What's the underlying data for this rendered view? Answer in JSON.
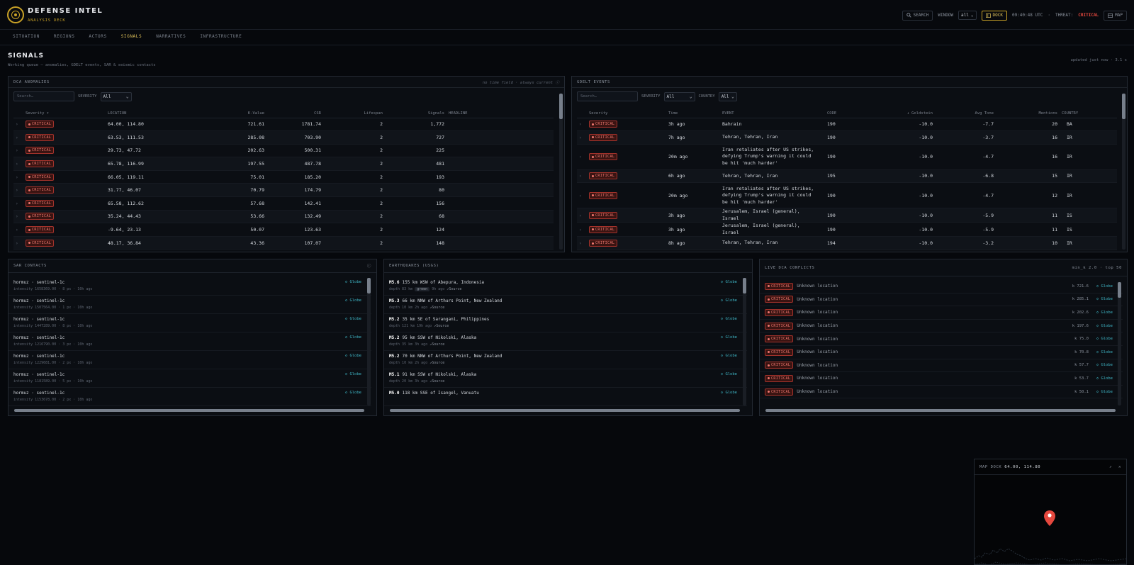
{
  "header": {
    "title": "DEFENSE INTEL",
    "subtitle": "ANALYSIS DECK",
    "search_label": "SEARCH",
    "window_label": "WINDOW",
    "window_value": "all",
    "dock_label": "DOCK",
    "time": "09:40:48 UTC",
    "threat_label": "THREAT:",
    "threat_value": "CRITICAL",
    "map_label": "MAP",
    "accent": "#c9a227",
    "critical_color": "#e5483e"
  },
  "tabs": [
    "SITUATION",
    "REGIONS",
    "ACTORS",
    "SIGNALS",
    "NARRATIVES",
    "INFRASTRUCTURE"
  ],
  "active_tab": "SIGNALS",
  "page": {
    "title": "SIGNALS",
    "subtitle": "Working queue — anomalies, GDELT events, SAR & seismic contacts",
    "updated": "updated just now · 3.1 s"
  },
  "dca": {
    "title": "DCA ANOMALIES",
    "note": "no time field · always current",
    "search_placeholder": "Search…",
    "severity_label": "SEVERITY",
    "severity_value": "All",
    "columns": [
      "Severity",
      "LOCATION",
      "K-Value",
      "CSR",
      "Lifespan",
      "Signals",
      "HEADLINE"
    ],
    "rows": [
      {
        "sev": "CRITICAL",
        "loc": "64.00, 114.80",
        "k": "721.61",
        "csr": "1781.74",
        "life": "2",
        "sig": "1,772"
      },
      {
        "sev": "CRITICAL",
        "loc": "63.53, 111.53",
        "k": "285.08",
        "csr": "703.90",
        "life": "2",
        "sig": "727"
      },
      {
        "sev": "CRITICAL",
        "loc": "29.73, 47.72",
        "k": "202.63",
        "csr": "500.31",
        "life": "2",
        "sig": "225"
      },
      {
        "sev": "CRITICAL",
        "loc": "65.78, 116.99",
        "k": "197.55",
        "csr": "487.78",
        "life": "2",
        "sig": "481"
      },
      {
        "sev": "CRITICAL",
        "loc": "66.05, 119.11",
        "k": "75.01",
        "csr": "185.20",
        "life": "2",
        "sig": "193"
      },
      {
        "sev": "CRITICAL",
        "loc": "31.77, 46.07",
        "k": "70.79",
        "csr": "174.79",
        "life": "2",
        "sig": "80"
      },
      {
        "sev": "CRITICAL",
        "loc": "65.58, 112.62",
        "k": "57.68",
        "csr": "142.41",
        "life": "2",
        "sig": "156"
      },
      {
        "sev": "CRITICAL",
        "loc": "35.24, 44.43",
        "k": "53.66",
        "csr": "132.49",
        "life": "2",
        "sig": "68"
      },
      {
        "sev": "CRITICAL",
        "loc": "-9.64, 23.13",
        "k": "50.07",
        "csr": "123.63",
        "life": "2",
        "sig": "124"
      },
      {
        "sev": "CRITICAL",
        "loc": "48.17, 36.84",
        "k": "43.36",
        "csr": "107.07",
        "life": "2",
        "sig": "148"
      }
    ]
  },
  "gdelt": {
    "title": "GDELT EVENTS",
    "search_placeholder": "Search…",
    "severity_label": "SEVERITY",
    "severity_value": "All",
    "country_label": "COUNTRY",
    "country_value": "All",
    "columns": [
      "Severity",
      "Time",
      "EVENT",
      "CODE",
      "↓ Goldstein",
      "Avg Tone",
      "Mentions",
      "COUNTRY"
    ],
    "rows": [
      {
        "sev": "CRITICAL",
        "time": "3h ago",
        "event": "Bahrain",
        "code": "190",
        "gold": "-10.0",
        "tone": "-7.7",
        "men": "20",
        "cty": "BA"
      },
      {
        "sev": "CRITICAL",
        "time": "7h ago",
        "event": "Tehran, Tehran, Iran",
        "code": "190",
        "gold": "-10.0",
        "tone": "-3.7",
        "men": "16",
        "cty": "IR"
      },
      {
        "sev": "CRITICAL",
        "time": "20m ago",
        "event": "Iran retaliates after US strikes, defying Trump's warning it could be hit 'much harder'",
        "code": "190",
        "gold": "-10.0",
        "tone": "-4.7",
        "men": "16",
        "cty": "IR"
      },
      {
        "sev": "CRITICAL",
        "time": "6h ago",
        "event": "Tehran, Tehran, Iran",
        "code": "195",
        "gold": "-10.0",
        "tone": "-6.8",
        "men": "15",
        "cty": "IR"
      },
      {
        "sev": "CRITICAL",
        "time": "20m ago",
        "event": "Iran retaliates after US strikes, defying Trump's warning it could be hit 'much harder'",
        "code": "190",
        "gold": "-10.0",
        "tone": "-4.7",
        "men": "12",
        "cty": "IR"
      },
      {
        "sev": "CRITICAL",
        "time": "3h ago",
        "event": "Jerusalem, Israel (general), Israel",
        "code": "190",
        "gold": "-10.0",
        "tone": "-5.9",
        "men": "11",
        "cty": "IS"
      },
      {
        "sev": "CRITICAL",
        "time": "3h ago",
        "event": "Jerusalem, Israel (general), Israel",
        "code": "190",
        "gold": "-10.0",
        "tone": "-5.9",
        "men": "11",
        "cty": "IS"
      },
      {
        "sev": "CRITICAL",
        "time": "8h ago",
        "event": "Tehran, Tehran, Iran",
        "code": "194",
        "gold": "-10.0",
        "tone": "-3.2",
        "men": "10",
        "cty": "IR"
      }
    ]
  },
  "sar": {
    "title": "SAR CONTACTS",
    "globe_label": "Globe",
    "items": [
      {
        "name": "hormuz · sentinel-1c",
        "meta": "intensity 1658369.00 · 8 px · 10h ago"
      },
      {
        "name": "hormuz · sentinel-1c",
        "meta": "intensity 1507564.00 · 1 px · 10h ago"
      },
      {
        "name": "hormuz · sentinel-1c",
        "meta": "intensity 1447289.00 · 8 px · 10h ago"
      },
      {
        "name": "hormuz · sentinel-1c",
        "meta": "intensity 1216790.00 · 3 px · 10h ago"
      },
      {
        "name": "hormuz · sentinel-1c",
        "meta": "intensity 1229681.00 · 2 px · 10h ago"
      },
      {
        "name": "hormuz · sentinel-1c",
        "meta": "intensity 1181589.00 · 5 px · 10h ago"
      },
      {
        "name": "hormuz · sentinel-1c",
        "meta": "intensity 1153678.00 · 2 px · 10h ago"
      }
    ]
  },
  "quakes": {
    "title": "EARTHQUAKES (USGS)",
    "globe_label": "Globe",
    "source_label": "Source",
    "items": [
      {
        "mag": "M5.6",
        "place": "155 km WSW of Abepura, Indonesia",
        "depth": "depth 83 km",
        "alert": "green",
        "ago": "9h ago"
      },
      {
        "mag": "M5.3",
        "place": "66 km NNW of Arthurs Point, New Zealand",
        "depth": "depth 10 km",
        "alert": "",
        "ago": "2h ago"
      },
      {
        "mag": "M5.2",
        "place": "35 km SE of Sarangani, Philippines",
        "depth": "depth 121 km",
        "alert": "",
        "ago": "19h ago"
      },
      {
        "mag": "M5.2",
        "place": "95 km SSW of Nikolski, Alaska",
        "depth": "depth 35 km",
        "alert": "",
        "ago": "3h ago"
      },
      {
        "mag": "M5.2",
        "place": "70 km NNW of Arthurs Point, New Zealand",
        "depth": "depth 10 km",
        "alert": "",
        "ago": "2h ago"
      },
      {
        "mag": "M5.1",
        "place": "91 km SSW of Nikolski, Alaska",
        "depth": "depth 20 km",
        "alert": "",
        "ago": "3h ago"
      },
      {
        "mag": "M5.0",
        "place": "118 km SSE of Isangel, Vanuatu",
        "depth": "",
        "alert": "",
        "ago": ""
      }
    ]
  },
  "conflicts": {
    "title": "LIVE DCA CONFLICTS",
    "meta": "min_k 2.0 · top 50",
    "globe_label": "Globe",
    "items": [
      {
        "sev": "CRITICAL",
        "loc": "Unknown location",
        "k": "k 721.6"
      },
      {
        "sev": "CRITICAL",
        "loc": "Unknown location",
        "k": "k 285.1"
      },
      {
        "sev": "CRITICAL",
        "loc": "Unknown location",
        "k": "k 202.6"
      },
      {
        "sev": "CRITICAL",
        "loc": "Unknown location",
        "k": "k 197.6"
      },
      {
        "sev": "CRITICAL",
        "loc": "Unknown location",
        "k": "k 75.0"
      },
      {
        "sev": "CRITICAL",
        "loc": "Unknown location",
        "k": "k 70.8"
      },
      {
        "sev": "CRITICAL",
        "loc": "Unknown location",
        "k": "k 57.7"
      },
      {
        "sev": "CRITICAL",
        "loc": "Unknown location",
        "k": "k 53.7"
      },
      {
        "sev": "CRITICAL",
        "loc": "Unknown location",
        "k": "k 50.1"
      }
    ]
  },
  "mapdock": {
    "title": "MAP DOCK",
    "coords": "64.00, 114.80"
  }
}
